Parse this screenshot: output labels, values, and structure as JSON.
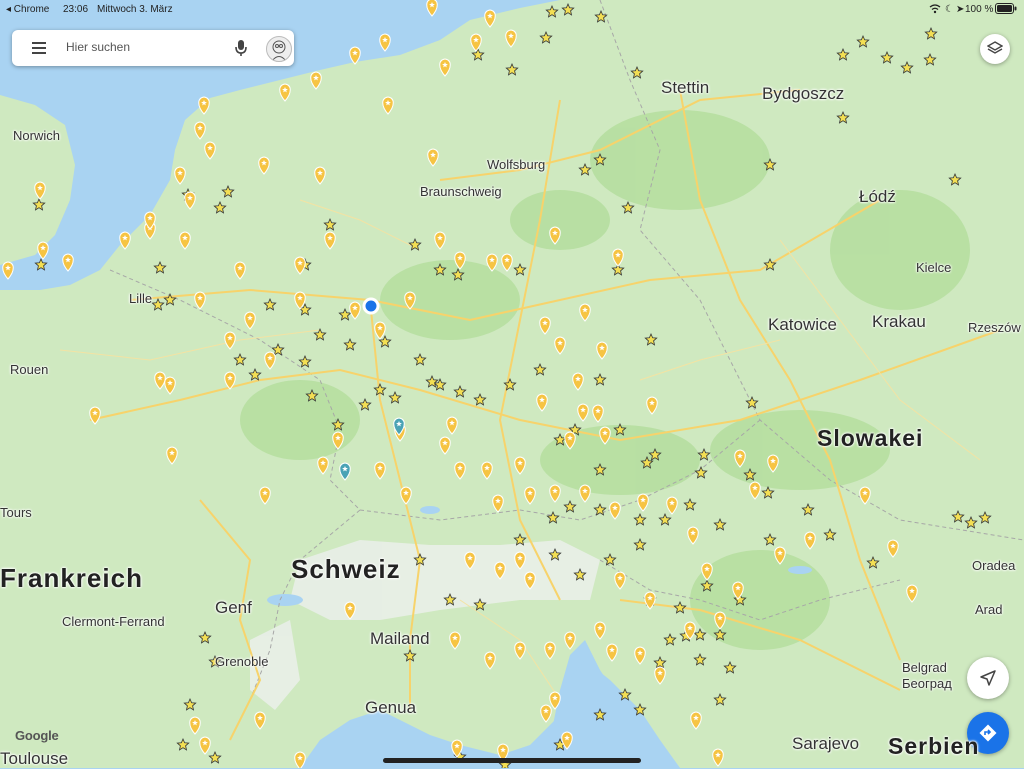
{
  "status_bar": {
    "back_app": "◂ Chrome",
    "time": "23:06",
    "date": "Mittwoch 3. März",
    "battery": "100 %"
  },
  "search": {
    "placeholder": "Hier suchen"
  },
  "brand": "Google",
  "icons": {
    "menu": "menu-icon",
    "mic": "mic-icon",
    "avatar": "avatar",
    "layers": "layers-icon",
    "locate": "navigation-arrow-icon",
    "directions": "directions-icon"
  },
  "colors": {
    "water": "#a9d3f2",
    "land": "#cfe9c0",
    "forest": "#a9d88f",
    "road": "#f7d36b",
    "pin": "#f6c443",
    "star": "#f3df54",
    "accent_blue": "#1a73e8"
  },
  "places": {
    "norwich": "Norwich",
    "lille": "Lille",
    "rouen": "Rouen",
    "tours": "Tours",
    "frankreich": "Frankreich",
    "clermont": "Clermont-Ferrand",
    "genf": "Genf",
    "grenoble": "Grenoble",
    "toulouse": "Toulouse",
    "schweiz": "Schweiz",
    "mailand": "Mailand",
    "genua": "Genua",
    "stettin": "Stettin",
    "bydgoszcz": "Bydgoszcz",
    "wolfsburg": "Wolfsburg",
    "braunschweig": "Braunschweig",
    "lodz": "Łódź",
    "kielce": "Kielce",
    "katowice": "Katowice",
    "krakau": "Krakau",
    "rzeszow": "Rzeszów",
    "slowakei": "Slowakei",
    "oradea": "Oradea",
    "arad": "Arad",
    "belgrad": "Belgrad",
    "beograd": "Београд",
    "sarajevo": "Sarajevo",
    "serbien": "Serbien"
  }
}
